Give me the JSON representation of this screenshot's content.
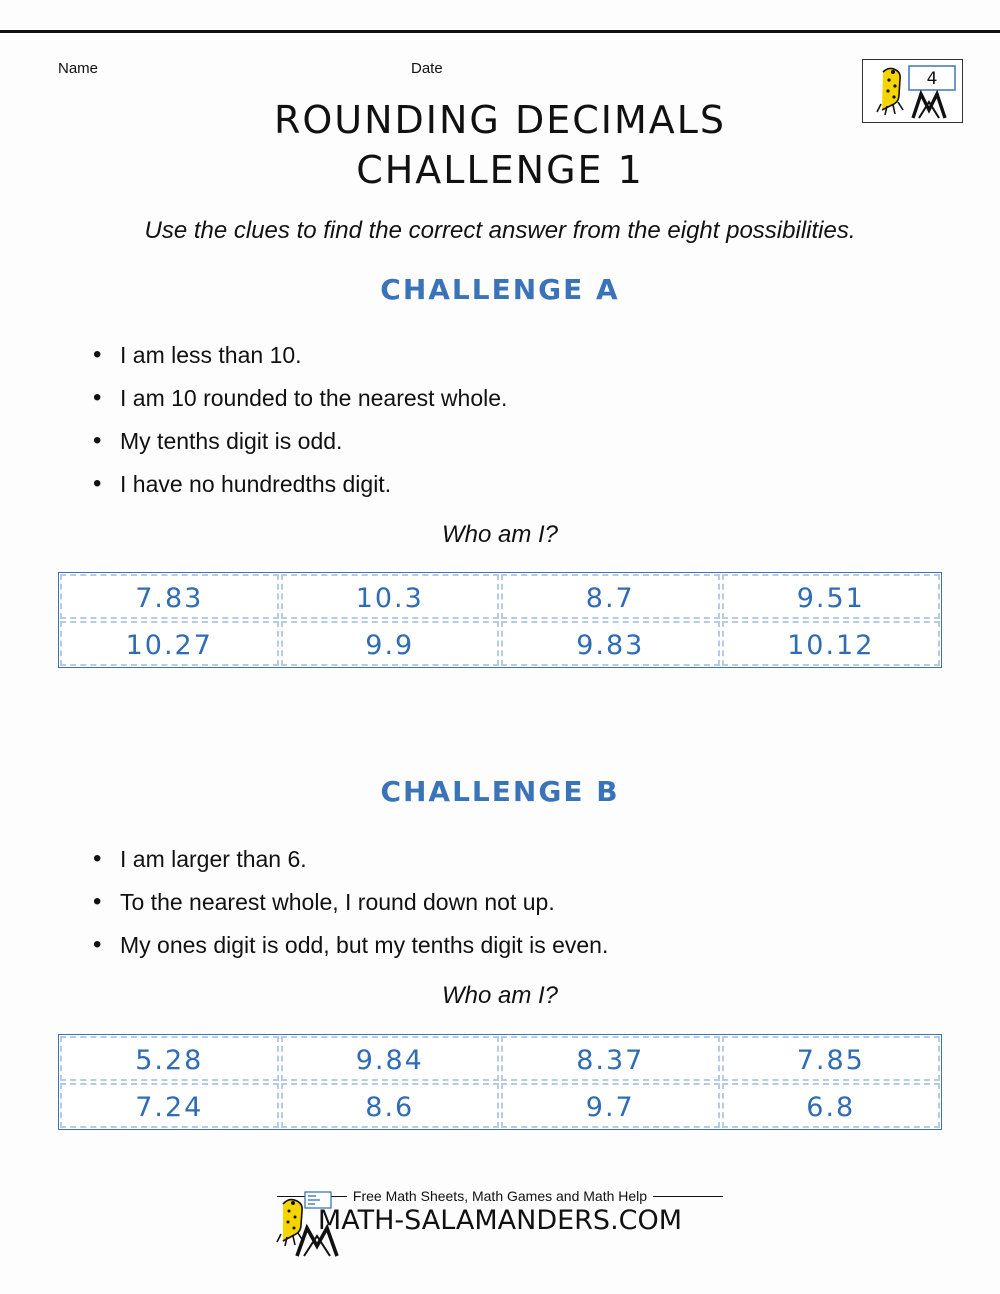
{
  "header": {
    "name_label": "Name",
    "date_label": "Date",
    "grade_badge": "4"
  },
  "title": {
    "line1": "ROUNDING DECIMALS",
    "line2": "CHALLENGE 1"
  },
  "subtitle": "Use the clues to find the correct answer from the eight possibilities.",
  "who_am_i": "Who am I?",
  "challenges": [
    {
      "heading": "CHALLENGE A",
      "clues": [
        "I am less than 10.",
        "I am 10 rounded to the nearest whole.",
        "My tenths digit is odd.",
        "I have no hundredths digit."
      ],
      "options": [
        [
          "7.83",
          "10.3",
          "8.7",
          "9.51"
        ],
        [
          "10.27",
          "9.9",
          "9.83",
          "10.12"
        ]
      ]
    },
    {
      "heading": "CHALLENGE B",
      "clues": [
        "I am larger than 6.",
        "To the nearest whole, I round down not up.",
        "My ones digit is odd, but my tenths digit is even."
      ],
      "options": [
        [
          "5.28",
          "9.84",
          "8.37",
          "7.85"
        ],
        [
          "7.24",
          "8.6",
          "9.7",
          "6.8"
        ]
      ]
    }
  ],
  "footer": {
    "tagline": "Free Math Sheets, Math Games and Math Help",
    "brand": "MATH-SALAMANDERS.COM"
  },
  "colors": {
    "accent_blue": "#3a73b8",
    "answer_blue": "#2f6cb5",
    "text": "#111111"
  }
}
